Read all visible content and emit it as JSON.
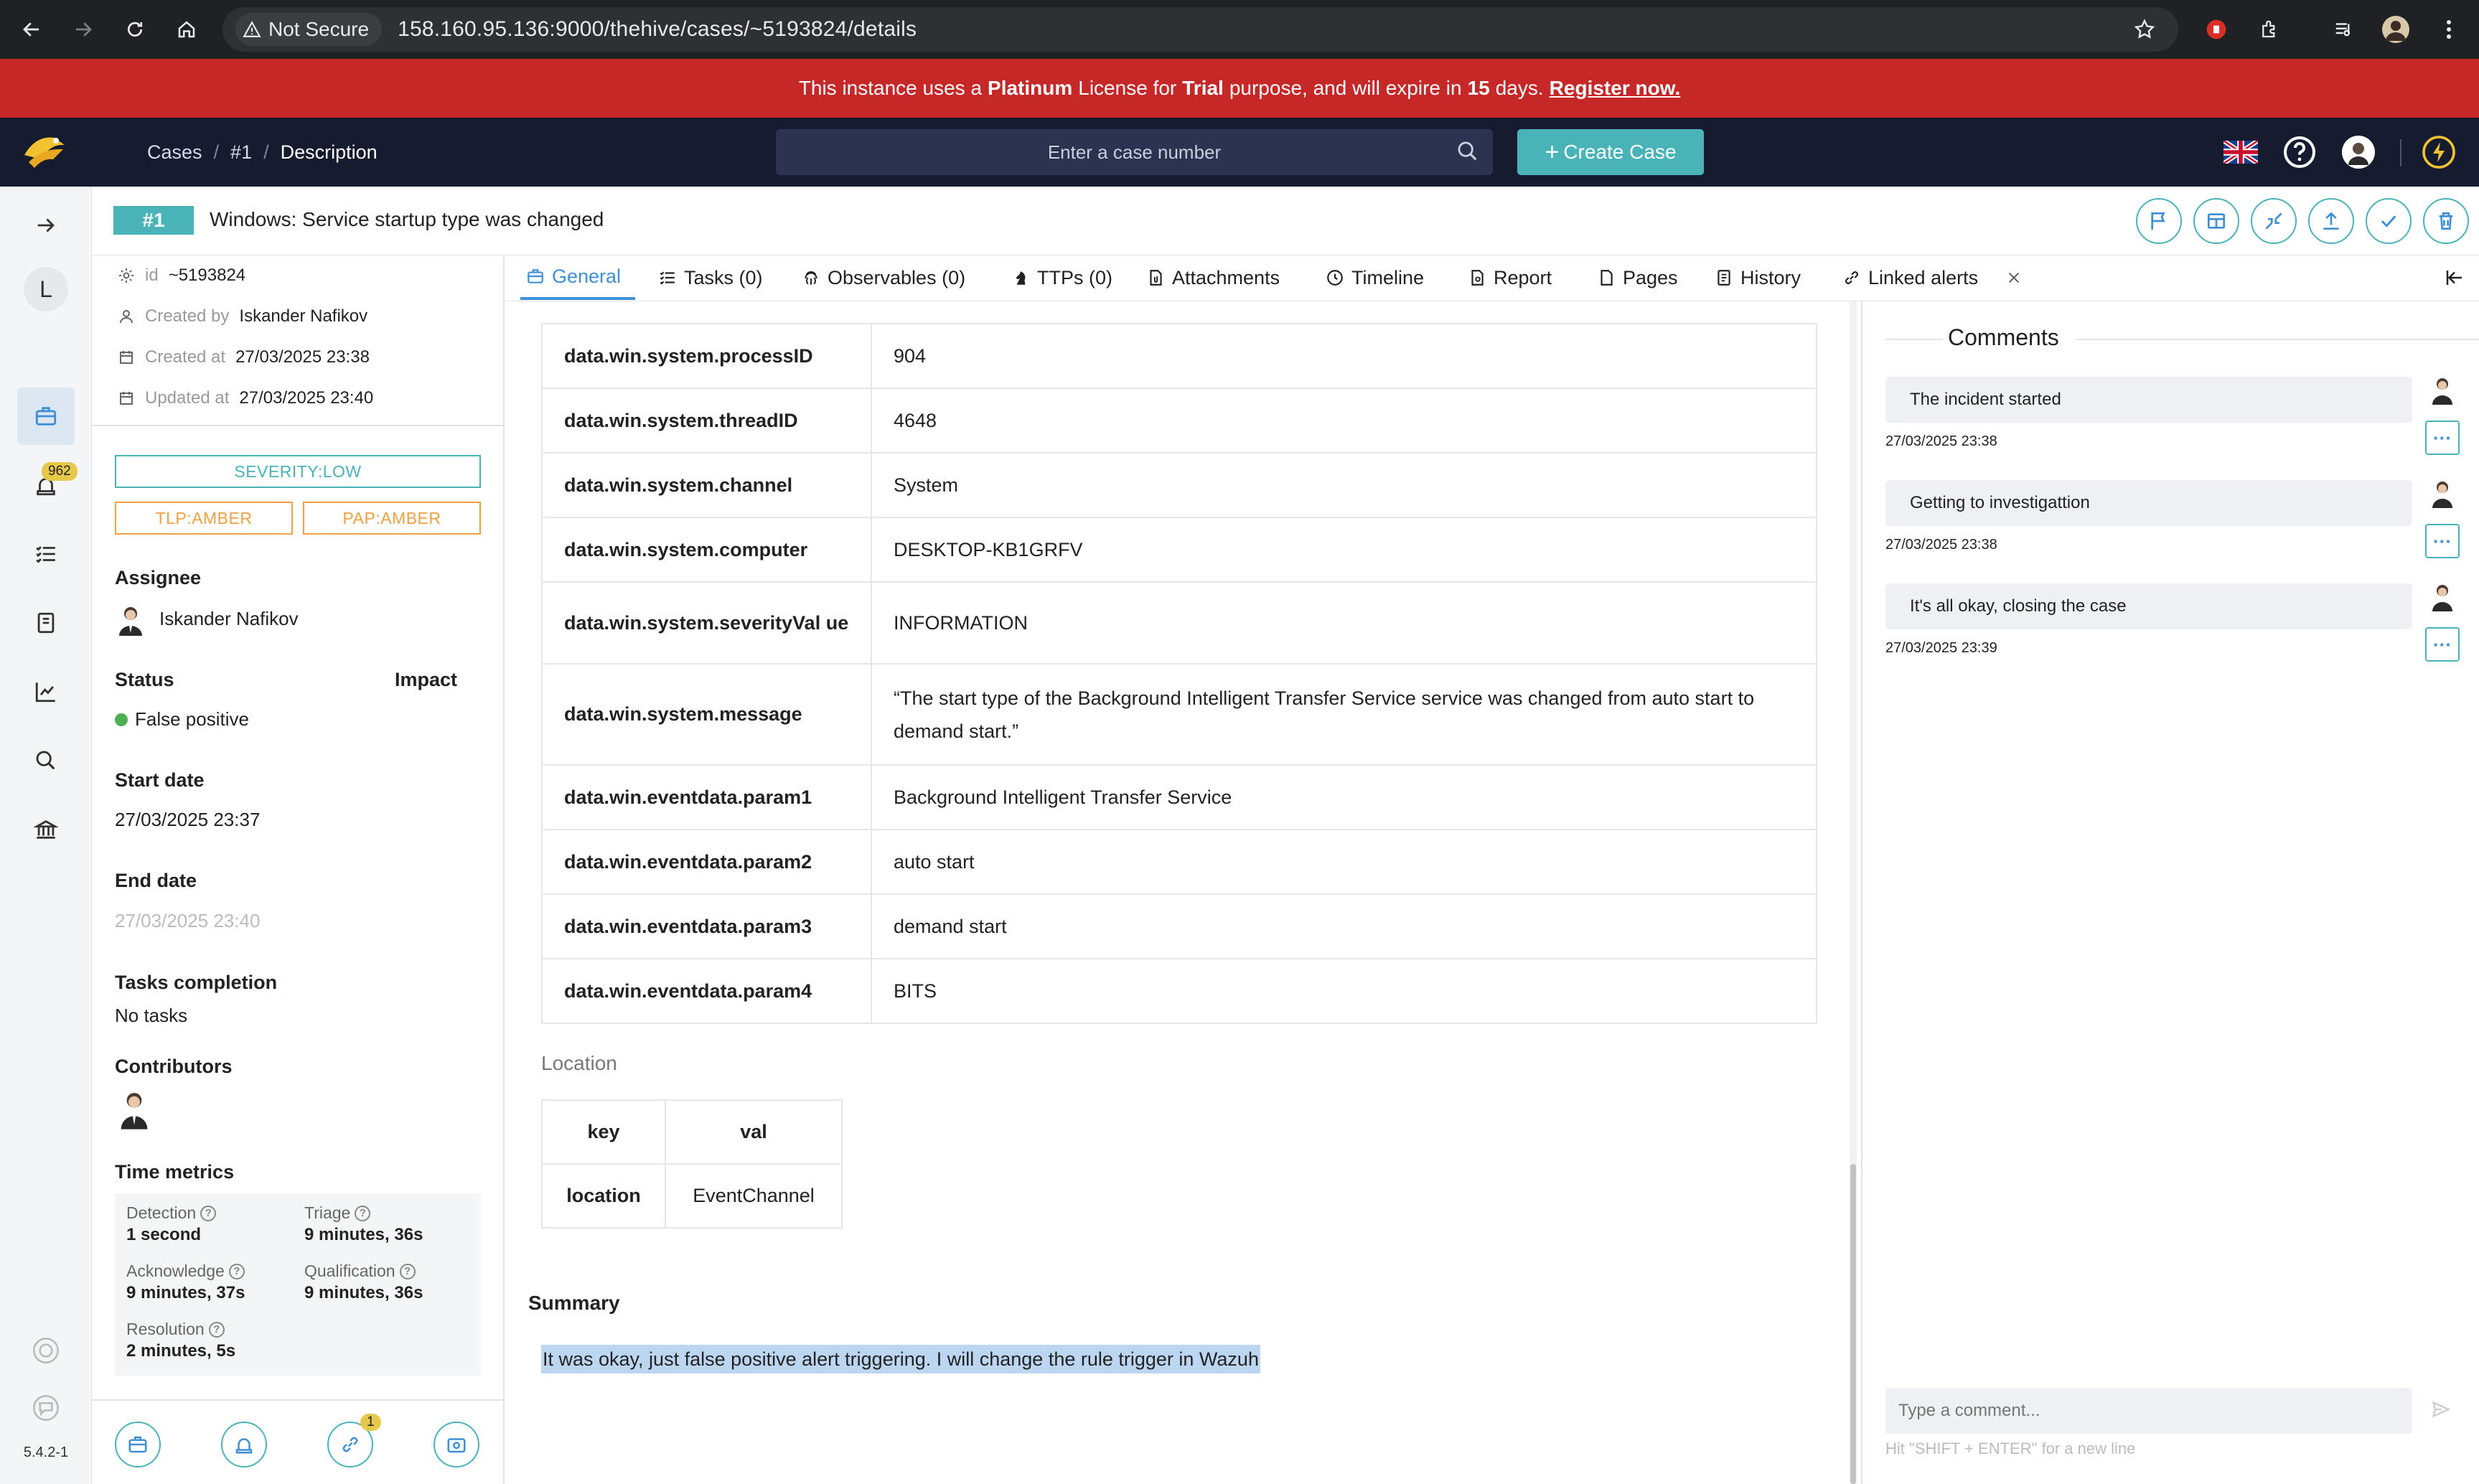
{
  "browser": {
    "not_secure": "Not Secure",
    "url": "158.160.95.136:9000/thehive/cases/~5193824/details"
  },
  "license": {
    "t1": "This instance uses a",
    "plan": "Platinum",
    "t2": "License for",
    "purpose": "Trial",
    "t3": "purpose, and will expire in",
    "days": "15",
    "t4": "days.",
    "register": "Register now."
  },
  "header": {
    "crumbs": [
      "Cases",
      "#1",
      "Description"
    ],
    "search_placeholder": "Enter a case number",
    "create_label": "Create Case"
  },
  "sidebar": {
    "avatar_letter": "L",
    "alerts_count": "962",
    "version": "5.4.2-1"
  },
  "case": {
    "number": "#1",
    "title": "Windows: Service startup type was changed",
    "id_label": "id",
    "id": "~5193824",
    "created_by_label": "Created by",
    "created_by": "Iskander Nafikov",
    "created_at_label": "Created at",
    "created_at": "27/03/2025 23:38",
    "updated_at_label": "Updated at",
    "updated_at": "27/03/2025 23:40",
    "severity": "SEVERITY:LOW",
    "tlp": "TLP:AMBER",
    "pap": "PAP:AMBER",
    "assignee_label": "Assignee",
    "assignee": "Iskander Nafikov",
    "status_label": "Status",
    "status": "False positive",
    "impact_label": "Impact",
    "start_label": "Start date",
    "start": "27/03/2025 23:37",
    "end_label": "End date",
    "end": "27/03/2025 23:40",
    "tasks_label": "Tasks completion",
    "tasks": "No tasks",
    "contributors_label": "Contributors",
    "time_metrics_label": "Time metrics",
    "metrics": {
      "detection_label": "Detection",
      "detection": "1 second",
      "triage_label": "Triage",
      "triage": "9 minutes, 36s",
      "ack_label": "Acknowledge",
      "ack": "9 minutes, 37s",
      "qual_label": "Qualification",
      "qual": "9 minutes, 36s",
      "res_label": "Resolution",
      "res": "2 minutes, 5s"
    },
    "bottom_badge": "1"
  },
  "tabs": [
    "General",
    "Tasks (0)",
    "Observables (0)",
    "TTPs (0)",
    "Attachments",
    "Timeline",
    "Report",
    "Pages",
    "History",
    "Linked alerts"
  ],
  "table": [
    {
      "k": "data.win.system.processID",
      "v": "904"
    },
    {
      "k": "data.win.system.threadID",
      "v": "4648"
    },
    {
      "k": "data.win.system.channel",
      "v": "System"
    },
    {
      "k": "data.win.system.computer",
      "v": "DESKTOP-KB1GRFV"
    },
    {
      "k": "data.win.system.severityVal ue",
      "v": "INFORMATION"
    },
    {
      "k": "data.win.system.message",
      "v": "“The start type of the Background Intelligent Transfer Service service was changed from auto start to demand start.”"
    },
    {
      "k": "data.win.eventdata.param1",
      "v": "Background Intelligent Transfer Service"
    },
    {
      "k": "data.win.eventdata.param2",
      "v": "auto start"
    },
    {
      "k": "data.win.eventdata.param3",
      "v": "demand start"
    },
    {
      "k": "data.win.eventdata.param4",
      "v": "BITS"
    }
  ],
  "location": {
    "title": "Location",
    "col_key": "key",
    "col_val": "val",
    "key": "location",
    "val": "EventChannel"
  },
  "summary": {
    "title": "Summary",
    "text": "It was okay, just false positive alert triggering. I will change the rule trigger in Wazuh"
  },
  "comments": {
    "title": "Comments",
    "items": [
      {
        "text": "The incident started",
        "date": "27/03/2025 23:38"
      },
      {
        "text": "Getting to investigattion",
        "date": "27/03/2025 23:38"
      },
      {
        "text": "It's all okay, closing the case",
        "date": "27/03/2025 23:39"
      }
    ],
    "placeholder": "Type a comment...",
    "hint": "Hit \"SHIFT + ENTER\" for a new line"
  },
  "colors": {
    "accent": "#4ab3b8",
    "tab_active": "#3f8fd6",
    "banner": "#c62828",
    "header": "#151c2f",
    "amber": "#f0a040"
  }
}
